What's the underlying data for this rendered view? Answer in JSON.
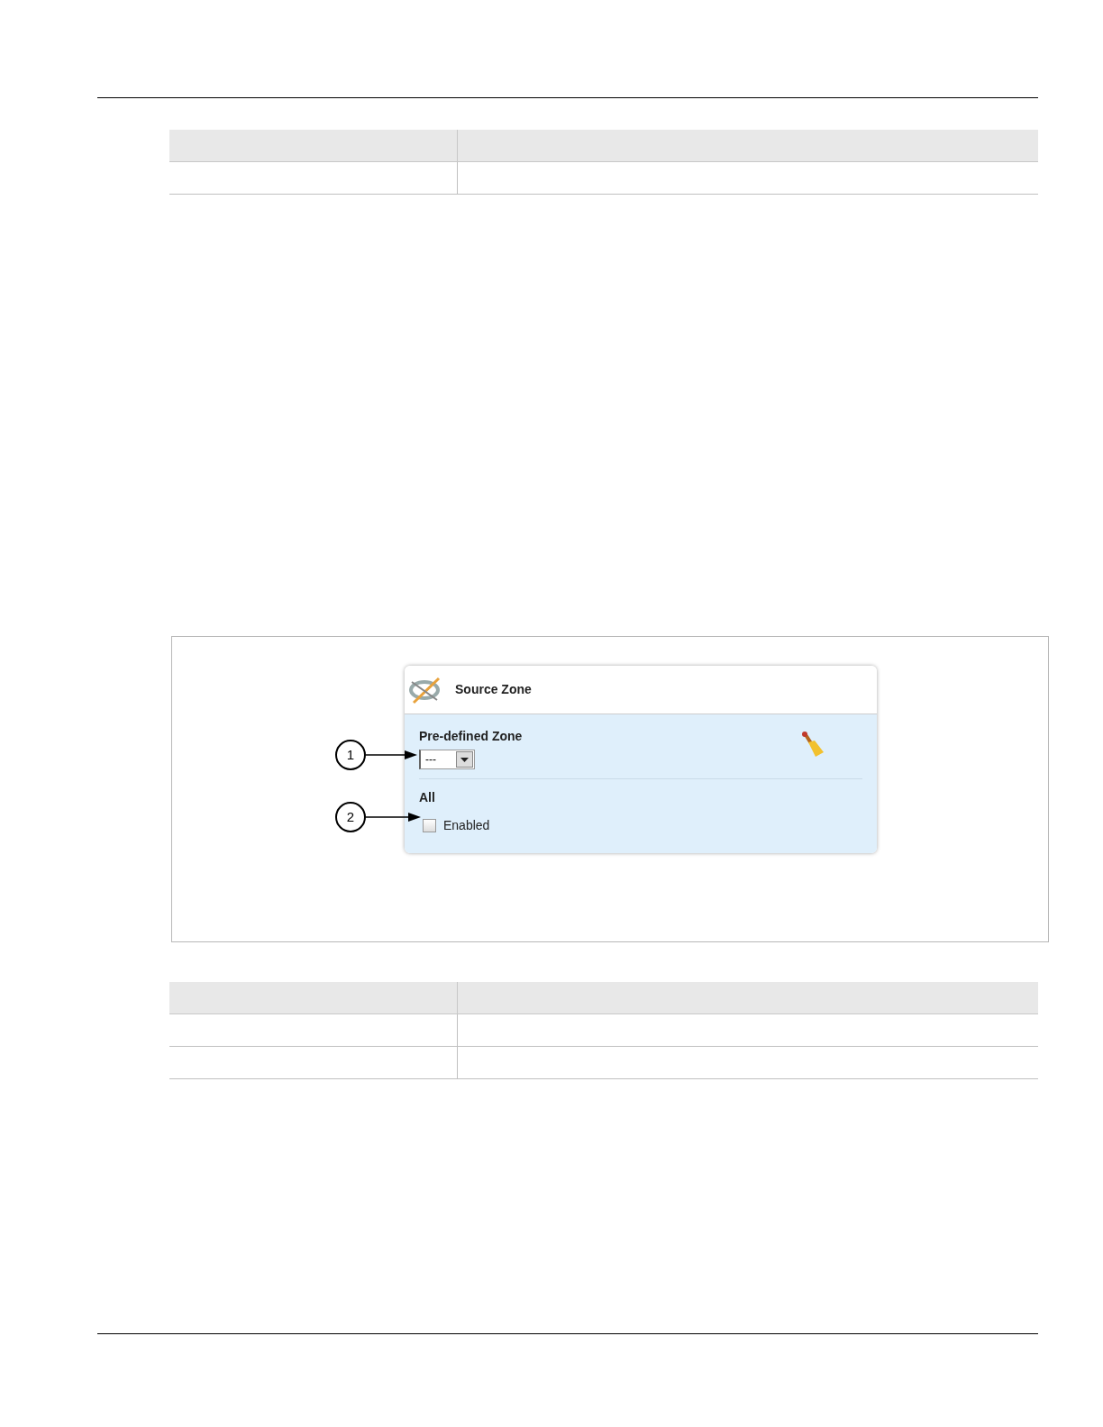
{
  "panel": {
    "title": "Source Zone",
    "sections": [
      {
        "kind": "dropdown",
        "label": "Pre-defined Zone",
        "value": "---",
        "callout": "1"
      },
      {
        "kind": "checkbox",
        "label": "All",
        "option": "Enabled",
        "checked": false,
        "callout": "2"
      }
    ]
  }
}
